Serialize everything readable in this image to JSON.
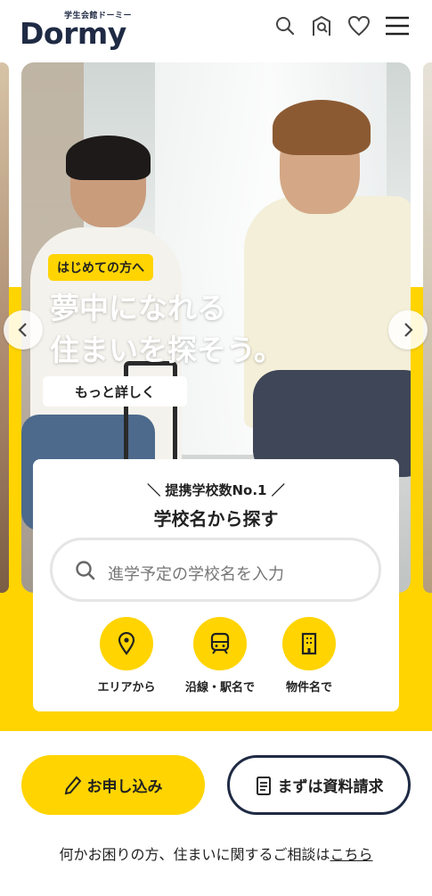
{
  "header": {
    "logo_tagline": "学生会館ドーミー",
    "logo_word": "Dormy",
    "icons": [
      "search-icon",
      "building-search-icon",
      "heart-icon",
      "menu-icon"
    ]
  },
  "hero": {
    "badge": "はじめての方へ",
    "title_line1": "夢中になれる",
    "title_line2": "住まいを探そう。",
    "more_button": "もっと詳しく"
  },
  "search": {
    "pre_title": "＼ 提携学校数No.1 ／",
    "title": "学校名から探す",
    "placeholder": "進学予定の学校名を入力",
    "options": [
      {
        "label": "エリアから",
        "icon": "map-pin-icon"
      },
      {
        "label": "沿線・駅名で",
        "icon": "train-icon"
      },
      {
        "label": "物件名で",
        "icon": "building-icon"
      }
    ]
  },
  "cta": {
    "apply_label": "お申し込み",
    "docs_label": "まずは資料請求"
  },
  "consult": {
    "text": "何かお困りの方、住まいに関するご相談は",
    "link": "こちら"
  },
  "colors": {
    "accent": "#ffd400",
    "navy": "#1f2a44"
  }
}
